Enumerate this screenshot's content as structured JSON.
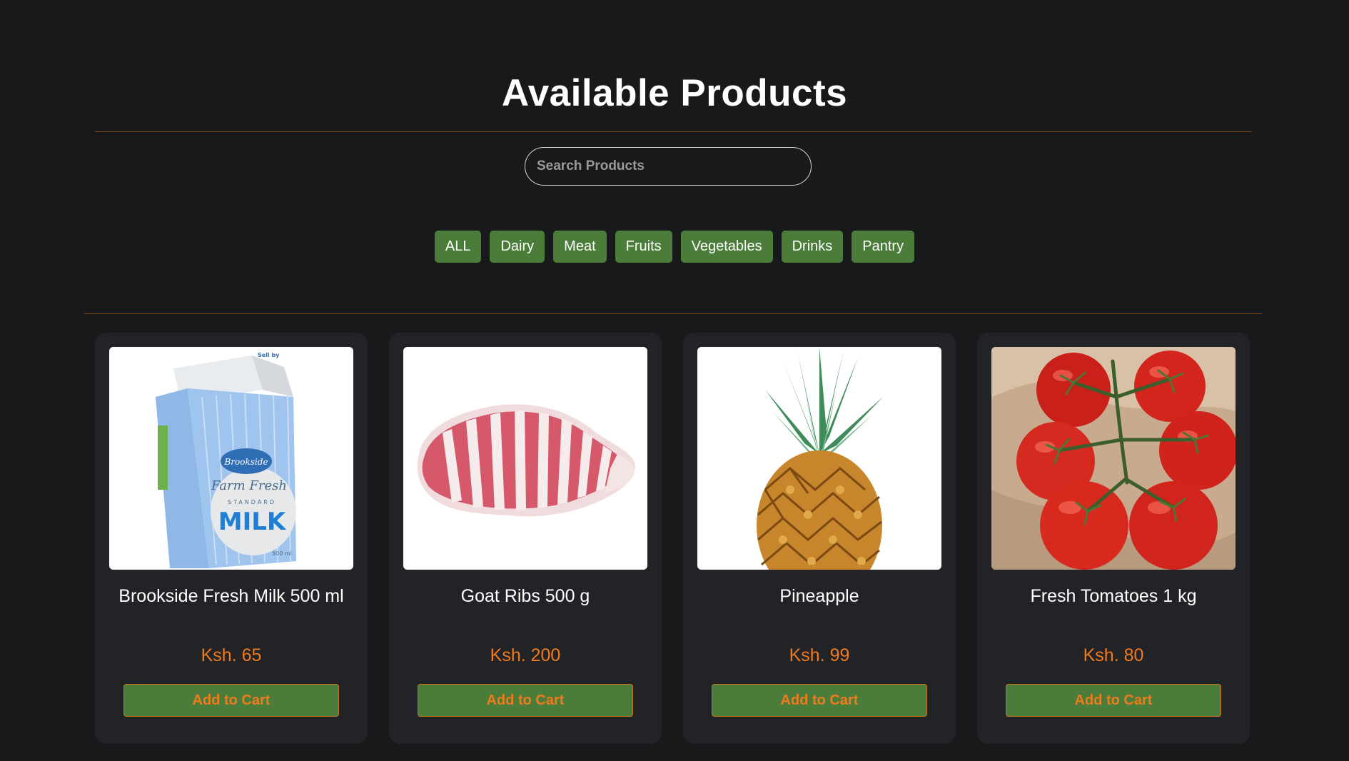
{
  "header": {
    "title": "Available Products"
  },
  "search": {
    "placeholder": "Search Products",
    "value": ""
  },
  "filters": [
    "ALL",
    "Dairy",
    "Meat",
    "Fruits",
    "Vegetables",
    "Drinks",
    "Pantry"
  ],
  "products": [
    {
      "name": "Brookside Fresh Milk 500 ml",
      "price": "Ksh. 65",
      "button": "Add to Cart",
      "image_icon": "milk-carton-icon",
      "carton_text": {
        "brand": "Brookside",
        "line1": "Farm Fresh",
        "line2": "STANDARD",
        "line3": "MILK",
        "volume": "500 ml",
        "sell_by": "Sell by"
      }
    },
    {
      "name": "Goat Ribs 500 g",
      "price": "Ksh. 200",
      "button": "Add to Cart",
      "image_icon": "goat-ribs-icon"
    },
    {
      "name": "Pineapple",
      "price": "Ksh. 99",
      "button": "Add to Cart",
      "image_icon": "pineapple-icon"
    },
    {
      "name": "Fresh Tomatoes 1 kg",
      "price": "Ksh. 80",
      "button": "Add to Cart",
      "image_icon": "tomatoes-icon"
    }
  ],
  "colors": {
    "background": "#18191b",
    "card": "#222326",
    "accent_green": "#4a7d39",
    "accent_orange": "#f07a1c",
    "divider": "#7a4a1e"
  }
}
